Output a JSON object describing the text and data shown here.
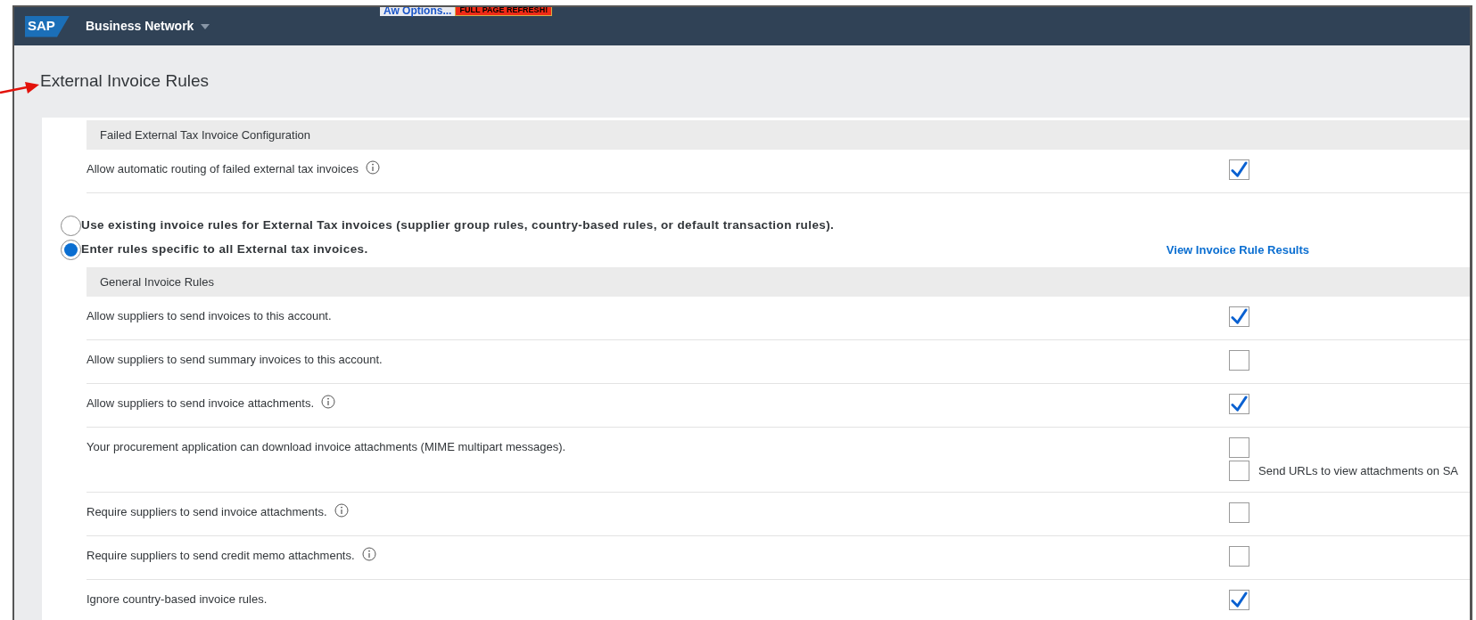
{
  "header": {
    "logo": "SAP",
    "title": "Business Network",
    "buttons": [
      {
        "label": "Aw Options..."
      },
      {
        "label": "FULL PAGE REFRESH!"
      }
    ]
  },
  "page_title": "External Invoice Rules",
  "failed_section": {
    "title": "Failed External Tax Invoice Configuration",
    "rules": [
      {
        "label": "Allow automatic routing of failed external tax invoices",
        "info": true,
        "checked": true
      }
    ]
  },
  "routing_options": [
    {
      "label": "Use existing invoice rules for External Tax invoices (supplier group rules, country-based rules, or default transaction rules).",
      "selected": false
    },
    {
      "label": "Enter rules specific to all External tax invoices.",
      "selected": true
    }
  ],
  "results_link": "View Invoice Rule Results",
  "general_section": {
    "title": "General Invoice Rules",
    "rules": [
      {
        "label": "Allow suppliers to send invoices to this account.",
        "info": false,
        "checked": true
      },
      {
        "label": "Allow suppliers to send summary invoices to this account.",
        "info": false,
        "checked": false
      },
      {
        "label": "Allow suppliers to send invoice attachments.",
        "info": true,
        "checked": true
      },
      {
        "label": "Your procurement application can download invoice attachments (MIME multipart messages).",
        "info": false,
        "checked": false,
        "sub_option": {
          "label": "Send URLs to view attachments on SA",
          "checked": false
        }
      },
      {
        "label": "Require suppliers to send invoice attachments.",
        "info": true,
        "checked": false
      },
      {
        "label": "Require suppliers to send credit memo attachments.",
        "info": true,
        "checked": false
      },
      {
        "label": "Ignore country-based invoice rules.",
        "info": false,
        "checked": true
      }
    ]
  }
}
